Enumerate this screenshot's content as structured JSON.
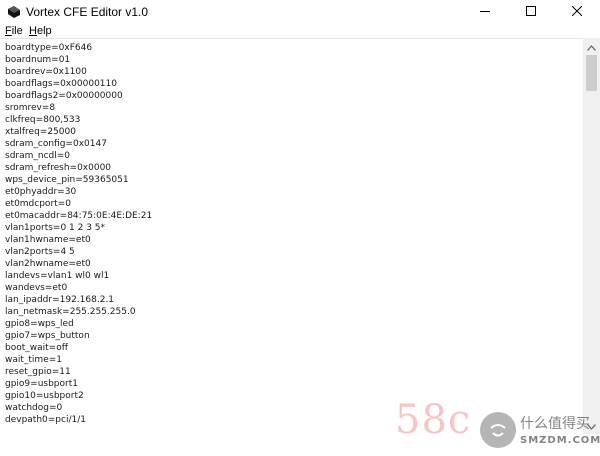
{
  "window": {
    "title": "Vortex CFE Editor v1.0",
    "icons": {
      "app": "vortex-app-icon",
      "minimize": "minimize-icon",
      "maximize": "maximize-icon",
      "close": "close-icon"
    }
  },
  "menu": {
    "items": [
      {
        "accel": "F",
        "rest": "ile"
      },
      {
        "accel": "H",
        "rest": "elp"
      }
    ]
  },
  "editor": {
    "lines": [
      "boardtype=0xF646",
      "boardnum=01",
      "boardrev=0x1100",
      "boardflags=0x00000110",
      "boardflags2=0x00000000",
      "sromrev=8",
      "clkfreq=800,533",
      "xtalfreq=25000",
      "sdram_config=0x0147",
      "sdram_ncdl=0",
      "sdram_refresh=0x0000",
      "wps_device_pin=59365051",
      "et0phyaddr=30",
      "et0mdcport=0",
      "et0macaddr=84:75:0E:4E:DE:21",
      "vlan1ports=0 1 2 3 5*",
      "vlan1hwname=et0",
      "vlan2ports=4 5",
      "vlan2hwname=et0",
      "landevs=vlan1 wl0 wl1",
      "wandevs=et0",
      "lan_ipaddr=192.168.2.1",
      "lan_netmask=255.255.255.0",
      "gpio8=wps_led",
      "gpio7=wps_button",
      "boot_wait=off",
      "wait_time=1",
      "reset_gpio=11",
      "gpio9=usbport1",
      "gpio10=usbport2",
      "watchdog=0",
      "devpath0=pci/1/1"
    ]
  },
  "scrollbar": {
    "up_icon": "scroll-up-arrow-icon",
    "down_icon": "scroll-down-arrow-icon",
    "position_fraction": 0.0,
    "visible_fraction": 0.1
  },
  "watermark": {
    "left_text": "58c",
    "right_cn": "什么值得买",
    "right_en": "SMZDM.COM",
    "logo_icon": "smzdm-logo-icon"
  },
  "colors": {
    "title_bg": "#ffffff",
    "scroll_track": "#f0f0f0",
    "scroll_thumb": "#cdcdcd",
    "text": "#1a1a1a"
  }
}
